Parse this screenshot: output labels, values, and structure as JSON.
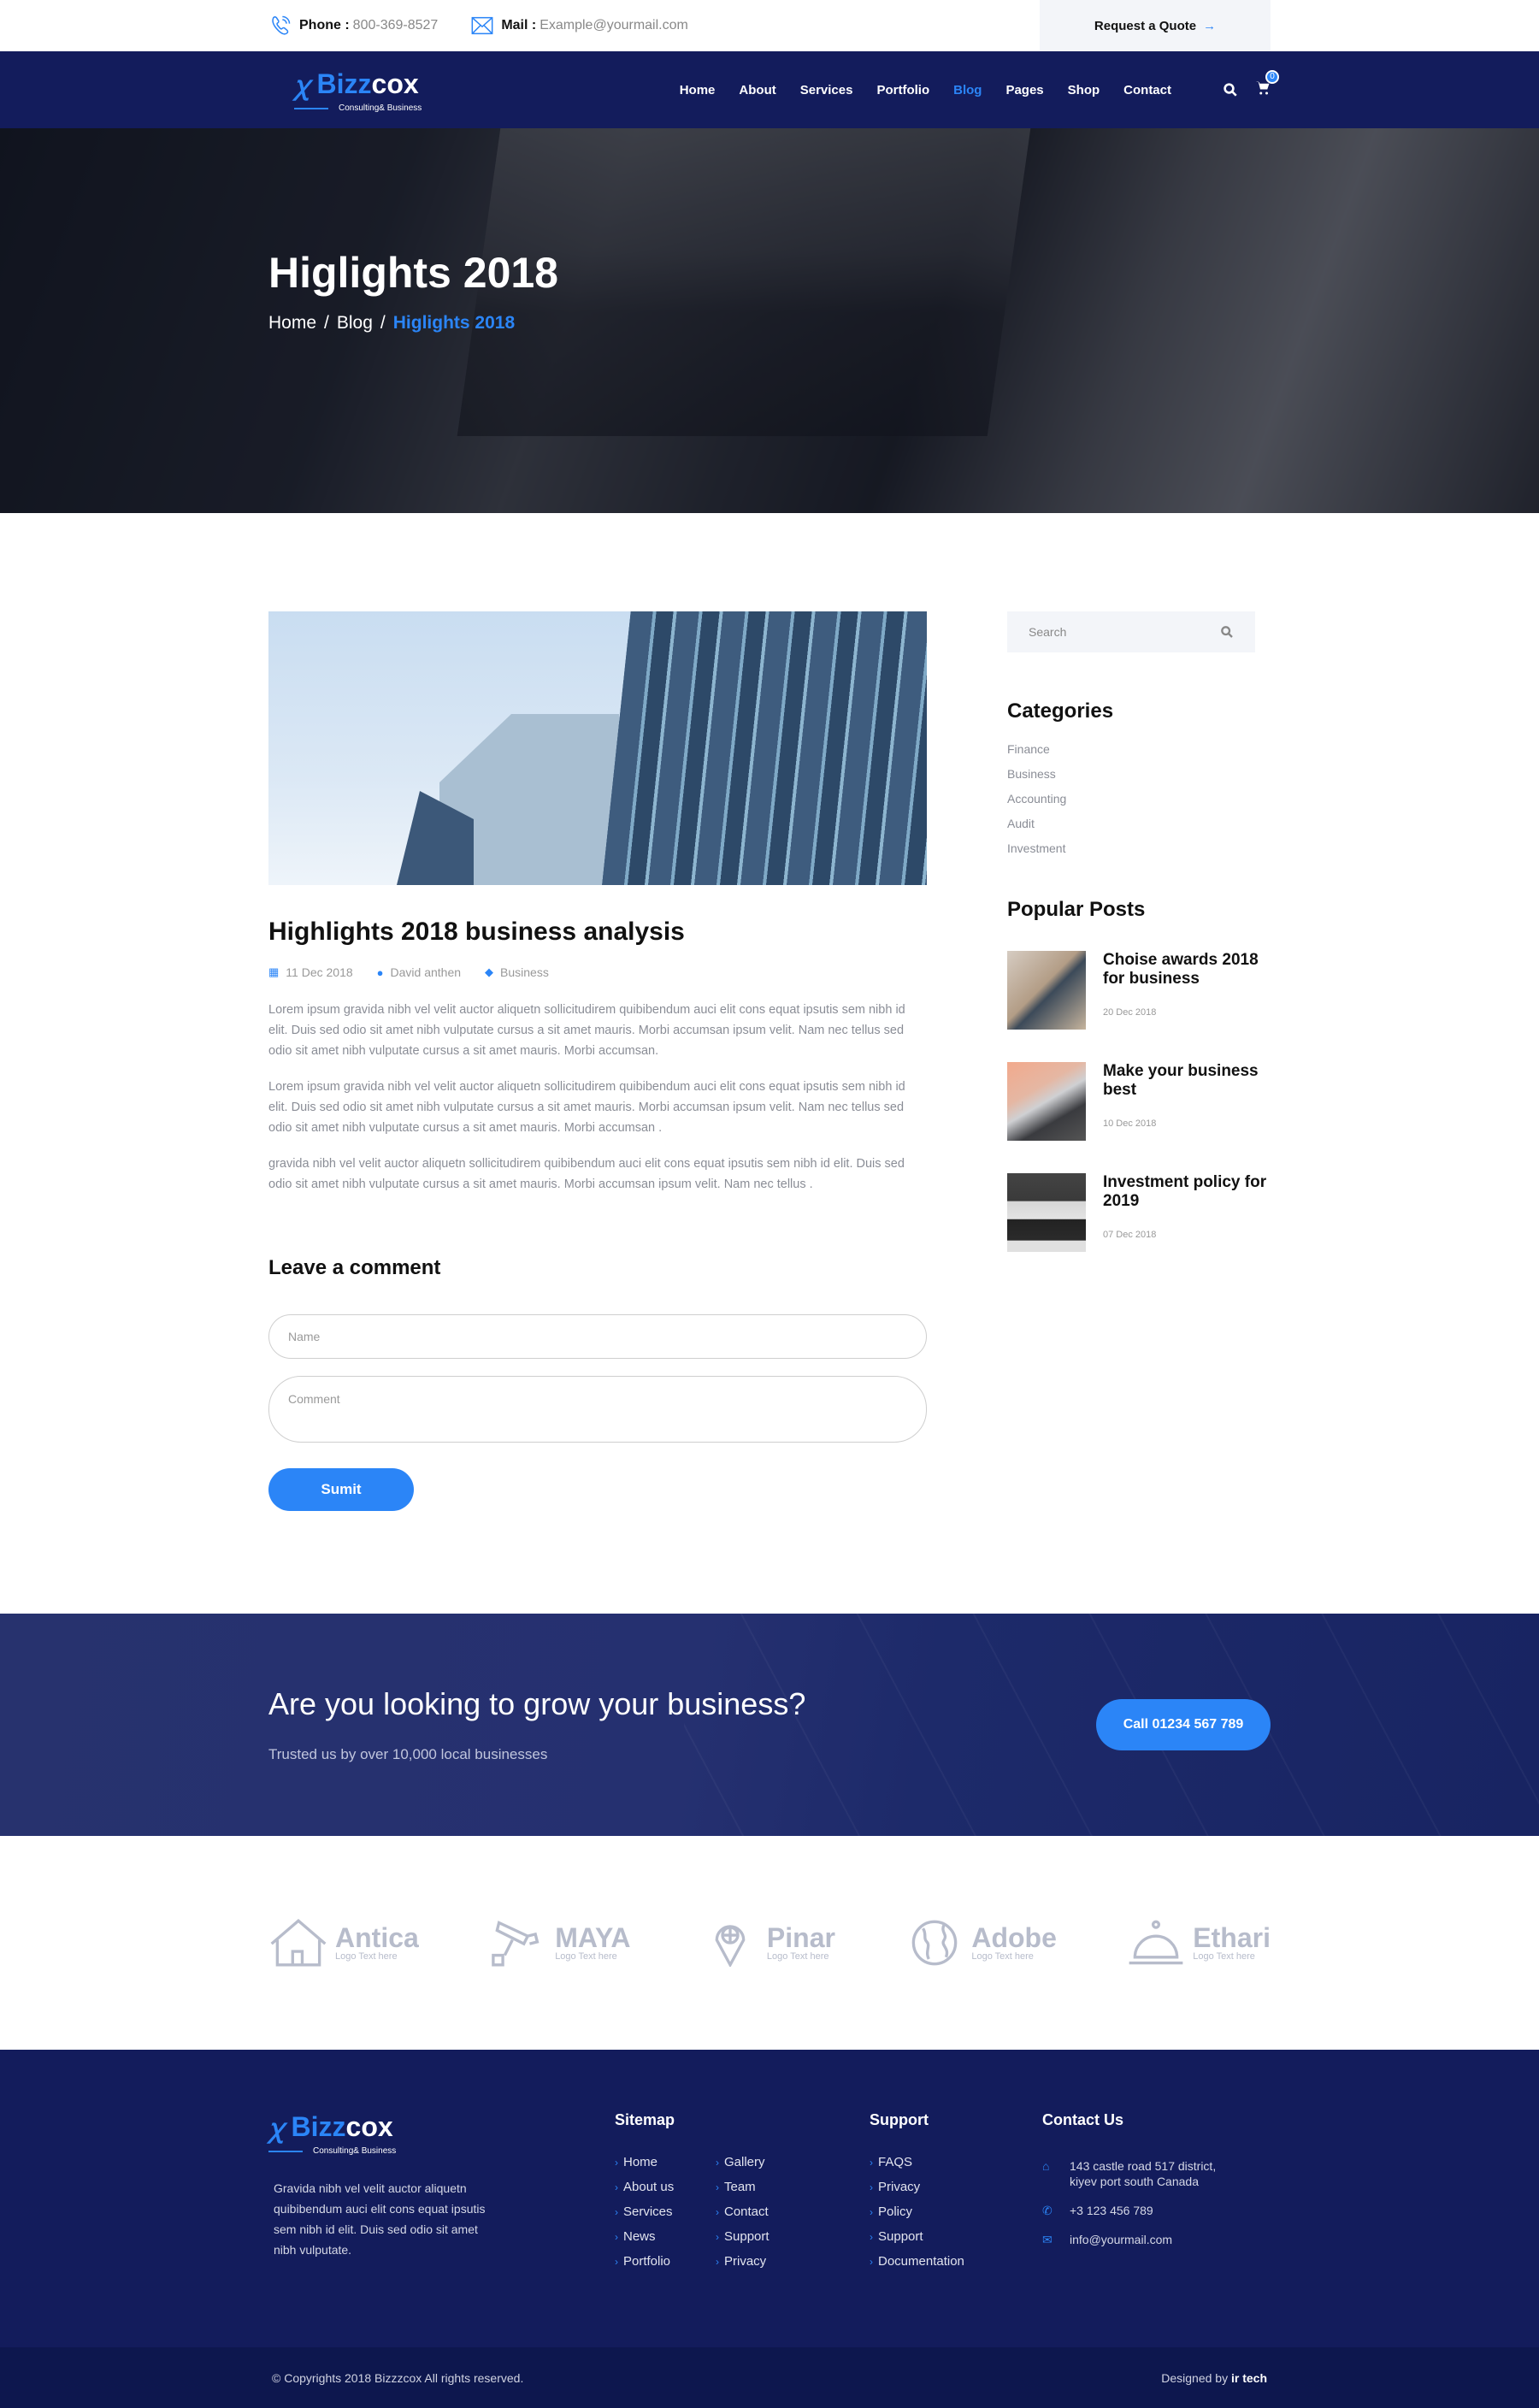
{
  "topbar": {
    "phone_label": "Phone :",
    "phone_value": "800-369-8527",
    "mail_label": "Mail :",
    "mail_value": "Example@yourmail.com",
    "quote_button": "Request a Quote",
    "quote_arrow": "→"
  },
  "brand": {
    "mark": "ꭓ",
    "name_part1": "Bizz",
    "name_part2": "cox",
    "tagline": "Consulting& Business"
  },
  "nav": {
    "items": [
      {
        "label": "Home",
        "active": false
      },
      {
        "label": "About",
        "active": false
      },
      {
        "label": "Services",
        "active": false
      },
      {
        "label": "Portfolio",
        "active": false
      },
      {
        "label": "Blog",
        "active": true
      },
      {
        "label": "Pages",
        "active": false
      },
      {
        "label": "Shop",
        "active": false
      },
      {
        "label": "Contact",
        "active": false
      }
    ],
    "cart_count": "0"
  },
  "hero": {
    "title": "Higlights 2018",
    "breadcrumb": [
      "Home",
      "Blog",
      "Higlights 2018"
    ],
    "separator": "/"
  },
  "post": {
    "title": "Highlights 2018 business analysis",
    "date": "11 Dec 2018",
    "author": "David anthen",
    "category": "Business",
    "paragraphs": [
      "Lorem ipsum gravida nibh vel velit auctor aliquetn sollicitudirem quibibendum auci elit cons equat ipsutis sem nibh id elit. Duis sed odio sit amet nibh vulputate cursus a sit amet mauris. Morbi accumsan ipsum velit. Nam nec tellus  sed odio sit amet nibh vulputate cursus a sit amet mauris. Morbi accumsan.",
      "Lorem ipsum gravida nibh vel velit auctor aliquetn sollicitudirem quibibendum auci elit cons equat ipsutis sem nibh id elit. Duis sed odio sit amet nibh vulputate cursus a sit amet mauris. Morbi accumsan ipsum velit. Nam nec tellus sed odio sit amet nibh vulputate cursus a sit amet mauris. Morbi accumsan .",
      "gravida nibh vel velit auctor aliquetn sollicitudirem quibibendum auci elit cons equat ipsutis sem nibh id elit. Duis sed odio sit amet nibh vulputate cursus a sit amet mauris. Morbi accumsan ipsum velit. Nam nec tellus ."
    ]
  },
  "comment_form": {
    "heading": "Leave a comment",
    "name_placeholder": "Name",
    "comment_placeholder": "Comment",
    "submit_label": "Sumit"
  },
  "sidebar": {
    "search_placeholder": "Search",
    "categories_heading": "Categories",
    "categories": [
      "Finance",
      "Business",
      "Accounting",
      "Audit",
      "Investment"
    ],
    "popular_heading": "Popular Posts",
    "popular_posts": [
      {
        "title": "Choise awards 2018 for business",
        "date": "20 Dec 2018"
      },
      {
        "title": "Make your business best",
        "date": "10 Dec 2018"
      },
      {
        "title": "Investment policy for 2019",
        "date": "07 Dec 2018"
      }
    ]
  },
  "cta": {
    "heading": "Are you looking to grow your business?",
    "subtext": "Trusted us by over 10,000 local businesses",
    "button": "Call 01234 567 789"
  },
  "brands": [
    {
      "name": "Antica",
      "sub": "Logo Text here",
      "icon": "house-icon"
    },
    {
      "name": "MAYA",
      "sub": "Logo Text here",
      "icon": "camera-icon"
    },
    {
      "name": "Pinar",
      "sub": "Logo Text here",
      "icon": "globe-pin-icon"
    },
    {
      "name": "Adobe",
      "sub": "Logo Text here",
      "icon": "world-map-icon"
    },
    {
      "name": "Ethari",
      "sub": "Logo Text here",
      "icon": "cloche-icon"
    }
  ],
  "footer": {
    "about": "Gravida nibh vel velit auctor aliquetn quibibendum auci elit cons equat ipsutis sem nibh id elit. Duis sed odio sit amet nibh vulputate.",
    "sitemap_heading": "Sitemap",
    "sitemap_col1": [
      "Home",
      "About us",
      "Services",
      "News",
      "Portfolio"
    ],
    "sitemap_col2": [
      "Gallery",
      "Team",
      "Contact",
      "Support",
      "Privacy"
    ],
    "support_heading": "Support",
    "support_links": [
      "FAQS",
      "Privacy",
      "Policy",
      "Support",
      "Documentation"
    ],
    "contact_heading": "Contact Us",
    "address": "143 castle road 517 district, kiyev port south Canada",
    "phone": "+3 123 456 789",
    "email": "info@yourmail.com",
    "copyright": "© Copyrights 2018 Bizzzcox All rights reserved.",
    "designed_by_label": "Designed by",
    "designed_by_name": "ir tech"
  },
  "colors": {
    "accent": "#2b85f7",
    "navy": "#131c5c",
    "footer_bottom": "#0d174e"
  }
}
